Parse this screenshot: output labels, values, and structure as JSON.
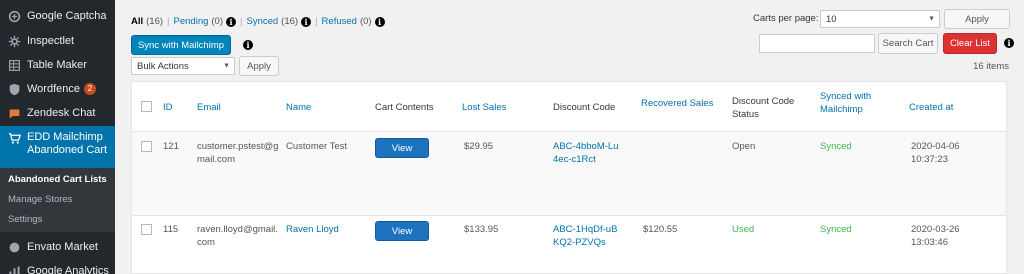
{
  "sidebar": {
    "items": [
      {
        "label": "Google Captcha",
        "icon": "captcha-icon"
      },
      {
        "label": "Inspectlet",
        "icon": "gear-icon"
      },
      {
        "label": "Table Maker",
        "icon": "table-icon"
      },
      {
        "label": "Wordfence",
        "icon": "shield-icon",
        "badge": "2"
      },
      {
        "label": "Zendesk Chat",
        "icon": "chat-icon"
      },
      {
        "label": "EDD Mailchimp Abandoned Cart",
        "icon": "cart-icon"
      },
      {
        "label": "Envato Market",
        "icon": "envato-icon"
      },
      {
        "label": "Google Analytics",
        "icon": "analytics-icon"
      }
    ],
    "submenu": [
      "Abandoned Cart Lists",
      "Manage Stores",
      "Settings"
    ]
  },
  "filters": [
    {
      "label": "All",
      "count": "(16)"
    },
    {
      "label": "Pending",
      "count": "(0)"
    },
    {
      "label": "Synced",
      "count": "(16)"
    },
    {
      "label": "Refused",
      "count": "(0)"
    }
  ],
  "info_glyph": "i",
  "sync_button": "Sync with Mailchimp",
  "bulk_actions": {
    "selected": "Bulk Actions",
    "apply": "Apply"
  },
  "per_page": {
    "label": "Carts per page:",
    "value": "10",
    "apply": "Apply"
  },
  "search": {
    "value": "",
    "button": "Search Cart"
  },
  "clear_button": "Clear List",
  "item_count": "16 items",
  "table": {
    "headers": [
      "ID",
      "Email",
      "Name",
      "Cart Contents",
      "Lost Sales",
      "Discount Code",
      "Recovered Sales",
      "Discount Code Status",
      "Synced with Mailchimp",
      "Created at"
    ],
    "rows": [
      {
        "id": "121",
        "email": "customer.pstest@gmail.com",
        "name": "Customer Test",
        "view": "View",
        "lost": "$29.95",
        "code": "ABC-4bboM-Lu4ec-c1Rct",
        "recovered": "",
        "status": "Open",
        "synced": "Synced",
        "created": "2020-04-06 10:37:23"
      },
      {
        "id": "115",
        "email": "raven.lloyd@gmail.com",
        "name": "Raven Lloyd",
        "view": "View",
        "lost": "$133.95",
        "code": "ABC-1HqDf-uBKQ2-PZVQs",
        "recovered": "$120.55",
        "status": "Used",
        "synced": "Synced",
        "created": "2020-03-26 13:03:46"
      }
    ]
  },
  "colors": {
    "sidebar": "#23282d",
    "active": "#0073aa",
    "link": "#0073aa",
    "green": "#46b450",
    "red": "#dc3232"
  }
}
